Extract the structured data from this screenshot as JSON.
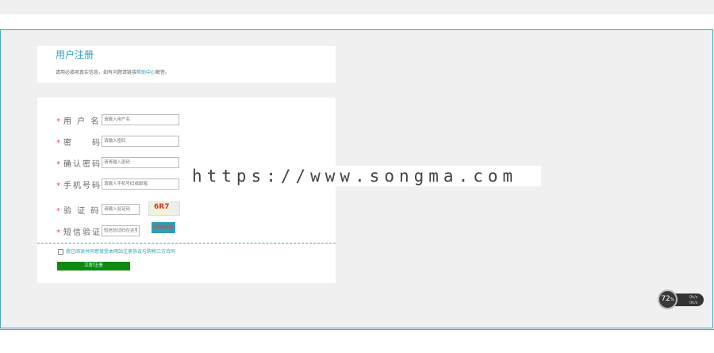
{
  "header": {
    "title": "用户注册",
    "desc_prefix": "请用必填项真实信息，如有问题请链接",
    "desc_link": "帮助中心",
    "desc_suffix": "解答。"
  },
  "form": {
    "required_mark": "*",
    "username": {
      "label": "用 户 名",
      "placeholder": "请输入用户名"
    },
    "password": {
      "label": "密　　码",
      "placeholder": "请输入密码"
    },
    "confirm": {
      "label": "确认密码",
      "placeholder": "请再输入密码"
    },
    "phone": {
      "label": "手机号码",
      "placeholder": "请输入手机号码或邮箱"
    },
    "captcha": {
      "label": "验 证 码",
      "placeholder": "请输入验证码",
      "image_text": "6R7"
    },
    "sms": {
      "label": "短信验证",
      "placeholder": "短信验证码在这里",
      "button": "获取验证码"
    },
    "agree_text": "我已阅读并同意接受本网站注册协议与购物三方合同",
    "submit": "立即注册"
  },
  "watermark": "https://www.songma.com",
  "speed_widget": {
    "value": "72",
    "unit": "%",
    "line1": "0k/s",
    "line2": "0k/s"
  }
}
